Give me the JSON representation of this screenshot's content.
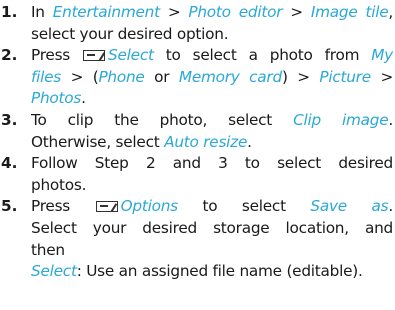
{
  "steps": [
    {
      "num": "1.",
      "parts": [
        {
          "t": "In "
        },
        {
          "t": "Entertainment",
          "hl": true
        },
        {
          "t": " > "
        },
        {
          "t": "Photo editor",
          "hl": true
        },
        {
          "t": " > "
        },
        {
          "t": "Image tile",
          "hl": true
        },
        {
          "t": ","
        },
        {
          "br": true
        },
        {
          "t": "select your desired option."
        }
      ]
    },
    {
      "num": "2.",
      "parts": [
        {
          "t": "Press "
        },
        {
          "key": "softkey-icon"
        },
        {
          "t": "Select",
          "hl": true
        },
        {
          "t": " to select a photo from "
        },
        {
          "t": "My",
          "hl": true
        },
        {
          "br": true
        },
        {
          "t": "files",
          "hl": true
        },
        {
          "t": " > ("
        },
        {
          "t": "Phone",
          "hl": true
        },
        {
          "t": " or "
        },
        {
          "t": "Memory card",
          "hl": true
        },
        {
          "t": ")  > "
        },
        {
          "t": "Picture",
          "hl": true
        },
        {
          "t": " >"
        },
        {
          "br": true
        },
        {
          "t": "Photos",
          "hl": true
        },
        {
          "t": "."
        }
      ]
    },
    {
      "num": "3.",
      "parts": [
        {
          "t": "To clip the photo, select "
        },
        {
          "t": "Clip image",
          "hl": true
        },
        {
          "t": "."
        },
        {
          "br": true
        },
        {
          "t": "Otherwise, select "
        },
        {
          "t": "Auto resize",
          "hl": true
        },
        {
          "t": "."
        }
      ]
    },
    {
      "num": "4.",
      "parts": [
        {
          "t": "Follow Step 2 and 3 to select desired"
        },
        {
          "br": true
        },
        {
          "t": "photos."
        }
      ]
    },
    {
      "num": "5.",
      "parts": [
        {
          "t": "Press "
        },
        {
          "key": "softkey-icon"
        },
        {
          "t": "Options",
          "hl": true
        },
        {
          "t": "  to select "
        },
        {
          "t": "Save as",
          "hl": true
        },
        {
          "t": "."
        },
        {
          "br": true
        },
        {
          "t": "Select your desired storage location, and"
        },
        {
          "br": true
        },
        {
          "t": "then"
        },
        {
          "br": true
        },
        {
          "t": "Select",
          "hl": true
        },
        {
          "t": ": Use an assigned file name (editable)."
        }
      ]
    }
  ],
  "colors": {
    "highlight": "#2aa9d6",
    "text": "#1a1a1a"
  }
}
